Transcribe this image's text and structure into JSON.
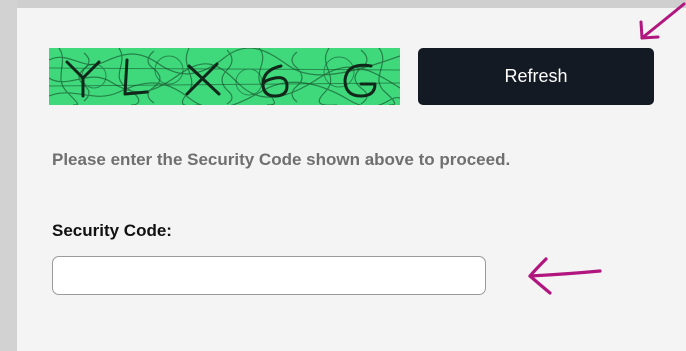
{
  "captcha": {
    "text": "YLX6G",
    "background_color": "#3fd97c"
  },
  "refresh": {
    "label": "Refresh"
  },
  "instruction": {
    "text": "Please enter the Security Code shown above to proceed."
  },
  "security_code": {
    "label": "Security Code:",
    "value": "",
    "placeholder": ""
  },
  "annotations": {
    "arrow_color": "#b0167e",
    "arrow_icons": [
      "arrow-icon",
      "arrow-icon"
    ]
  }
}
